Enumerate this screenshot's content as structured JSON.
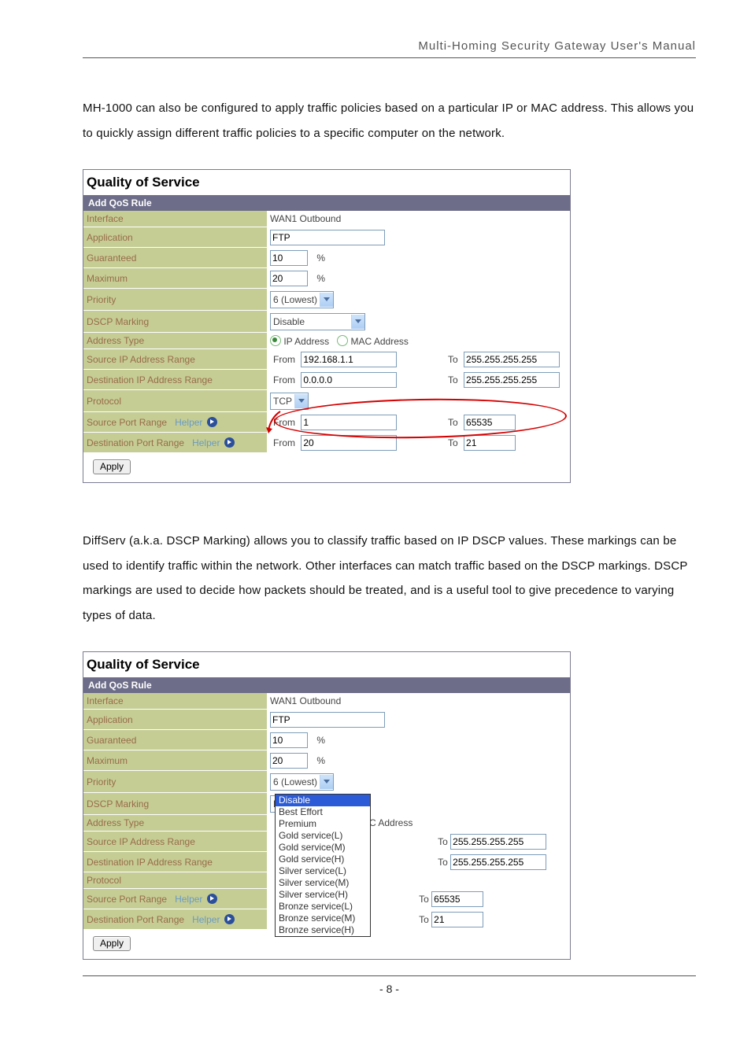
{
  "header": "Multi-Homing  Security  Gateway  User's  Manual",
  "para1": "MH-1000 can also be configured to apply traffic policies based on a particular IP or MAC address. This allows you to quickly assign different traffic policies to a specific computer on the network.",
  "para2": "DiffServ (a.k.a. DSCP Marking) allows you to classify traffic based on IP DSCP values. These markings can be used to identify traffic within the network. Other interfaces can match traffic based on the DSCP markings. DSCP markings are used to decide how packets should be treated, and is a useful tool to give precedence to varying types of data.",
  "panel": {
    "title": "Quality of Service",
    "sub": "Add QoS Rule",
    "labels": {
      "interface": "Interface",
      "application": "Application",
      "guaranteed": "Guaranteed",
      "maximum": "Maximum",
      "priority": "Priority",
      "dscp": "DSCP Marking",
      "addrtype": "Address Type",
      "srcip": "Source IP Address Range",
      "dstip": "Destination IP Address Range",
      "protocol": "Protocol",
      "srcport": "Source Port Range",
      "dstport": "Destination Port Range",
      "helper": "Helper",
      "from": "From",
      "to": "To",
      "pct": "%",
      "ip": "IP Address",
      "mac": "MAC Address",
      "caddr": "C Address",
      "apply": "Apply"
    },
    "values": {
      "interface": "WAN1 Outbound",
      "application": "FTP",
      "guaranteed": "10",
      "maximum": "20",
      "priority": "6 (Lowest)",
      "dscp": "Disable",
      "srcip_from": "192.168.1.1",
      "srcip_to": "255.255.255.255",
      "dstip_from": "0.0.0.0",
      "dstip_to": "255.255.255.255",
      "protocol": "TCP",
      "srcport_from": "1",
      "srcport_to": "65535",
      "dstport_from": "20",
      "dstport_to": "21"
    }
  },
  "dscp_options": [
    "Disable",
    "Best Effort",
    "Premium",
    "Gold service(L)",
    "Gold service(M)",
    "Gold service(H)",
    "Silver service(L)",
    "Silver service(M)",
    "Silver service(H)",
    "Bronze service(L)",
    "Bronze service(M)",
    "Bronze service(H)"
  ],
  "page_number": "- 8 -"
}
